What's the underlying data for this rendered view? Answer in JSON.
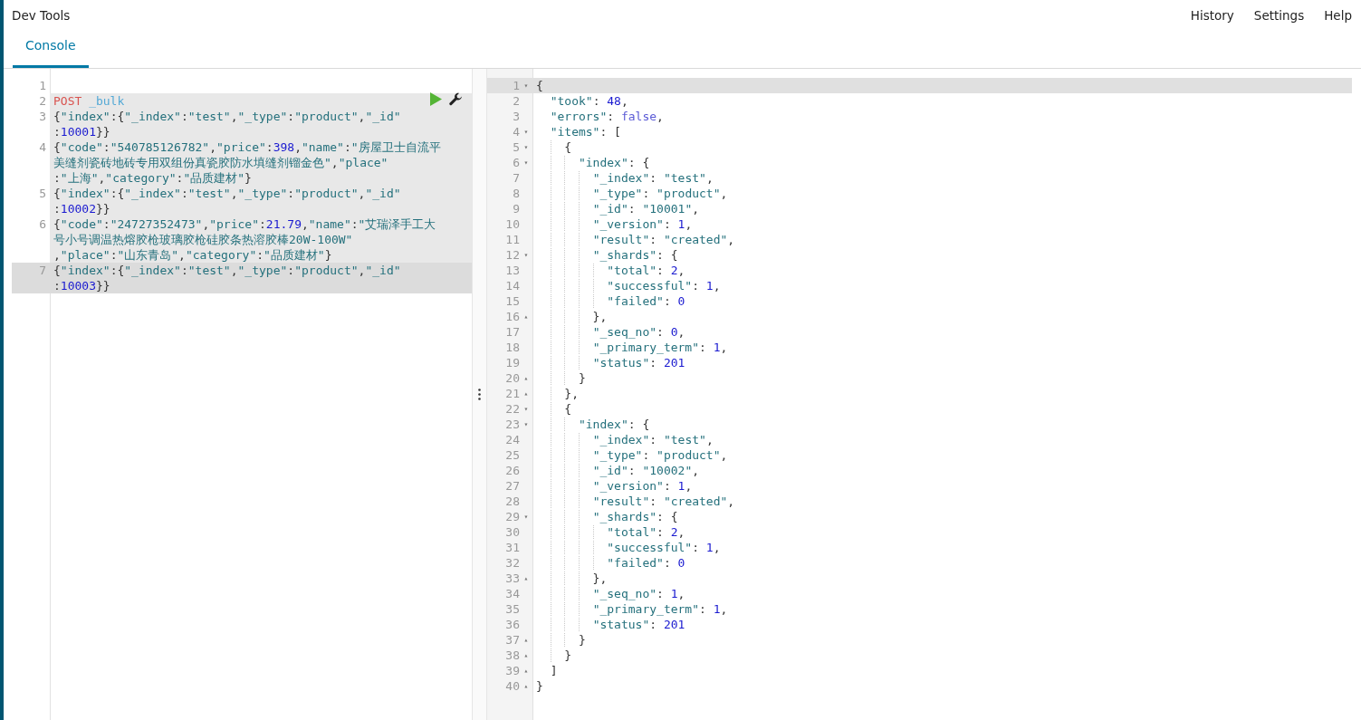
{
  "header": {
    "title": "Dev Tools",
    "nav": [
      "History",
      "Settings",
      "Help"
    ]
  },
  "tabs": [
    {
      "label": "Console",
      "selected": true
    }
  ],
  "request_editor": {
    "lines": [
      {
        "number": "1",
        "kind": "json",
        "in_request": false,
        "active": false
      },
      {
        "number": "2",
        "kind": "request",
        "in_request": true,
        "active": false,
        "rows": [
          "POST _bulk"
        ]
      },
      {
        "number": "3",
        "kind": "json",
        "in_request": true,
        "active": false,
        "rows": [
          "{\"index\":{\"_index\":\"test\",\"_type\":\"product\",\"_id\"",
          ":10001}}"
        ]
      },
      {
        "number": "4",
        "kind": "json",
        "in_request": true,
        "active": false,
        "rows": [
          "{\"code\":\"540785126782\",\"price\":398,\"name\":\"房屋卫士自流平",
          "美缝剂瓷砖地砖专用双组份真瓷胶防水填缝剂镏金色\",\"place\"",
          ":\"上海\",\"category\":\"品质建材\"}"
        ]
      },
      {
        "number": "5",
        "kind": "json",
        "in_request": true,
        "active": false,
        "rows": [
          "{\"index\":{\"_index\":\"test\",\"_type\":\"product\",\"_id\"",
          ":10002}}"
        ]
      },
      {
        "number": "6",
        "kind": "json",
        "in_request": true,
        "active": false,
        "rows": [
          "{\"code\":\"24727352473\",\"price\":21.79,\"name\":\"艾瑞泽手工大",
          "号小号调温热熔胶枪玻璃胶枪硅胶条热溶胶棒20W-100W\"",
          ",\"place\":\"山东青岛\",\"category\":\"品质建材\"}"
        ]
      },
      {
        "number": "7",
        "kind": "json",
        "in_request": true,
        "active": true,
        "rows": [
          "{\"index\":{\"_index\":\"test\",\"_type\":\"product\",\"_id\"",
          ":10003}}"
        ]
      }
    ]
  },
  "response_editor": {
    "lines": [
      {
        "number": "1",
        "fold": "▾",
        "active": true,
        "text": "{"
      },
      {
        "number": "2",
        "active": false,
        "text": "  \"took\": 48,"
      },
      {
        "number": "3",
        "active": false,
        "text": "  \"errors\": false,"
      },
      {
        "number": "4",
        "fold": "▾",
        "active": false,
        "text": "  \"items\": ["
      },
      {
        "number": "5",
        "fold": "▾",
        "active": false,
        "text": "    {"
      },
      {
        "number": "6",
        "fold": "▾",
        "active": false,
        "text": "      \"index\": {"
      },
      {
        "number": "7",
        "active": false,
        "text": "        \"_index\": \"test\","
      },
      {
        "number": "8",
        "active": false,
        "text": "        \"_type\": \"product\","
      },
      {
        "number": "9",
        "active": false,
        "text": "        \"_id\": \"10001\","
      },
      {
        "number": "10",
        "active": false,
        "text": "        \"_version\": 1,"
      },
      {
        "number": "11",
        "active": false,
        "text": "        \"result\": \"created\","
      },
      {
        "number": "12",
        "fold": "▾",
        "active": false,
        "text": "        \"_shards\": {"
      },
      {
        "number": "13",
        "active": false,
        "text": "          \"total\": 2,"
      },
      {
        "number": "14",
        "active": false,
        "text": "          \"successful\": 1,"
      },
      {
        "number": "15",
        "active": false,
        "text": "          \"failed\": 0"
      },
      {
        "number": "16",
        "fold": "▴",
        "active": false,
        "text": "        },"
      },
      {
        "number": "17",
        "active": false,
        "text": "        \"_seq_no\": 0,"
      },
      {
        "number": "18",
        "active": false,
        "text": "        \"_primary_term\": 1,"
      },
      {
        "number": "19",
        "active": false,
        "text": "        \"status\": 201"
      },
      {
        "number": "20",
        "fold": "▴",
        "active": false,
        "text": "      }"
      },
      {
        "number": "21",
        "fold": "▴",
        "active": false,
        "text": "    },"
      },
      {
        "number": "22",
        "fold": "▾",
        "active": false,
        "text": "    {"
      },
      {
        "number": "23",
        "fold": "▾",
        "active": false,
        "text": "      \"index\": {"
      },
      {
        "number": "24",
        "active": false,
        "text": "        \"_index\": \"test\","
      },
      {
        "number": "25",
        "active": false,
        "text": "        \"_type\": \"product\","
      },
      {
        "number": "26",
        "active": false,
        "text": "        \"_id\": \"10002\","
      },
      {
        "number": "27",
        "active": false,
        "text": "        \"_version\": 1,"
      },
      {
        "number": "28",
        "active": false,
        "text": "        \"result\": \"created\","
      },
      {
        "number": "29",
        "fold": "▾",
        "active": false,
        "text": "        \"_shards\": {"
      },
      {
        "number": "30",
        "active": false,
        "text": "          \"total\": 2,"
      },
      {
        "number": "31",
        "active": false,
        "text": "          \"successful\": 1,"
      },
      {
        "number": "32",
        "active": false,
        "text": "          \"failed\": 0"
      },
      {
        "number": "33",
        "fold": "▴",
        "active": false,
        "text": "        },"
      },
      {
        "number": "34",
        "active": false,
        "text": "        \"_seq_no\": 1,"
      },
      {
        "number": "35",
        "active": false,
        "text": "        \"_primary_term\": 1,"
      },
      {
        "number": "36",
        "active": false,
        "text": "        \"status\": 201"
      },
      {
        "number": "37",
        "fold": "▴",
        "active": false,
        "text": "      }"
      },
      {
        "number": "38",
        "fold": "▴",
        "active": false,
        "text": "    }"
      },
      {
        "number": "39",
        "fold": "▴",
        "active": false,
        "text": "  ]"
      },
      {
        "number": "40",
        "fold": "▴",
        "active": false,
        "text": "}"
      }
    ]
  }
}
